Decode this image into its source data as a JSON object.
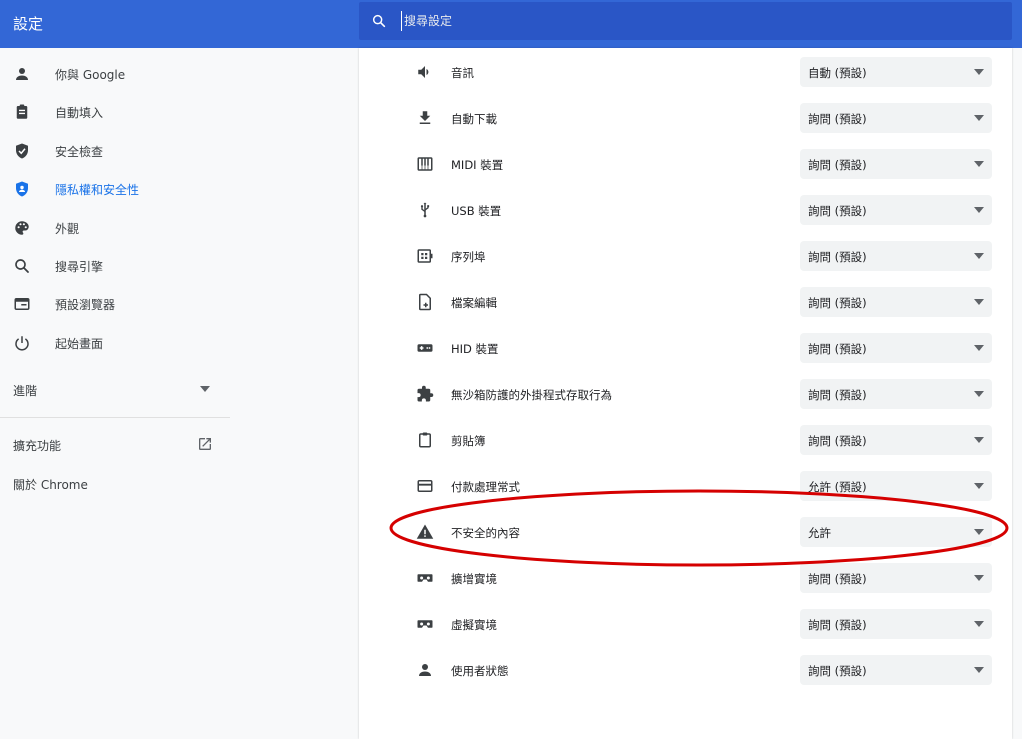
{
  "header": {
    "title": "設定",
    "search": {
      "placeholder": "搜尋設定",
      "value": ""
    }
  },
  "sidebar": {
    "items": [
      {
        "label": "你與 Google",
        "icon": "person-icon"
      },
      {
        "label": "自動填入",
        "icon": "clipboard-icon"
      },
      {
        "label": "安全檢查",
        "icon": "shield-check-icon"
      },
      {
        "label": "隱私權和安全性",
        "icon": "privacy-shield-icon",
        "active": true
      },
      {
        "label": "外觀",
        "icon": "palette-icon"
      },
      {
        "label": "搜尋引擎",
        "icon": "search-icon"
      },
      {
        "label": "預設瀏覽器",
        "icon": "browser-icon"
      },
      {
        "label": "起始畫面",
        "icon": "power-icon"
      }
    ],
    "advanced": {
      "label": "進階",
      "icon": "caret-down-icon"
    },
    "extensions": {
      "label": "擴充功能",
      "icon": "open-in-new-icon"
    },
    "about": {
      "label": "關於 Chrome"
    }
  },
  "permissions": [
    {
      "label": "音訊",
      "value": "自動 (預設)",
      "icon": "speaker-icon"
    },
    {
      "label": "自動下載",
      "value": "詢問 (預設)",
      "icon": "download-icon"
    },
    {
      "label": "MIDI 裝置",
      "value": "詢問 (預設)",
      "icon": "piano-icon"
    },
    {
      "label": "USB 裝置",
      "value": "詢問 (預設)",
      "icon": "usb-icon"
    },
    {
      "label": "序列埠",
      "value": "詢問 (預設)",
      "icon": "serial-port-icon"
    },
    {
      "label": "檔案編輯",
      "value": "詢問 (預設)",
      "icon": "file-edit-icon"
    },
    {
      "label": "HID 裝置",
      "value": "詢問 (預設)",
      "icon": "gamepad-icon"
    },
    {
      "label": "無沙箱防護的外掛程式存取行為",
      "value": "詢問 (預設)",
      "icon": "puzzle-icon"
    },
    {
      "label": "剪貼簿",
      "value": "詢問 (預設)",
      "icon": "clipboard-icon"
    },
    {
      "label": "付款處理常式",
      "value": "允許 (預設)",
      "icon": "credit-card-icon"
    },
    {
      "label": "不安全的內容",
      "value": "允許",
      "icon": "warning-icon"
    },
    {
      "label": "擴增實境",
      "value": "詢問 (預設)",
      "icon": "vr-headset-icon"
    },
    {
      "label": "虛擬實境",
      "value": "詢問 (預設)",
      "icon": "vr-headset-icon"
    },
    {
      "label": "使用者狀態",
      "value": "詢問 (預設)",
      "icon": "person-icon"
    }
  ],
  "colors": {
    "header_bg": "#3367d6",
    "search_bg": "#2a56c6",
    "active_nav": "#1a73e8",
    "annotation_red": "#d50000"
  }
}
